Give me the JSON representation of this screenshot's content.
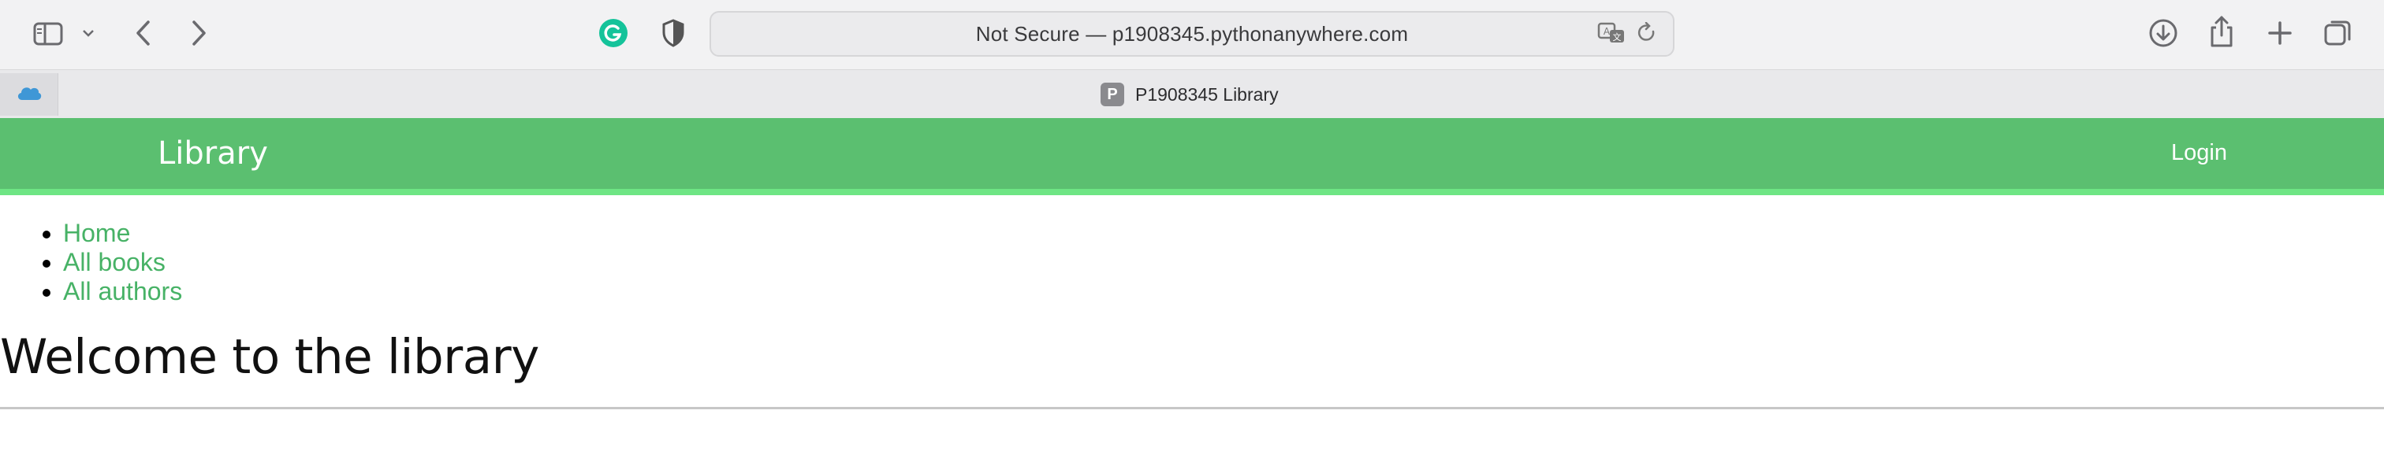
{
  "browser": {
    "address": "Not Secure — p1908345.pythonanywhere.com",
    "tab_title": "P1908345 Library",
    "tab_favicon_letter": "P",
    "icons": {
      "sidebar": "sidebar-icon",
      "sidebar_menu": "chevron-down-icon",
      "back": "back-arrow-icon",
      "forward": "forward-arrow-icon",
      "grammarly": "grammarly-icon",
      "privacy": "shield-icon",
      "translate": "translate-icon",
      "reload": "reload-icon",
      "downloads": "download-icon",
      "share": "share-icon",
      "new_tab": "plus-icon",
      "tab_overview": "tab-overview-icon",
      "pinned": "cloud-icon"
    }
  },
  "navbar": {
    "brand": "Library",
    "login": "Login",
    "color": "#5bbf70",
    "stripe_color": "#6ee584"
  },
  "nav_links": {
    "home": "Home",
    "books": "All books",
    "authors": "All authors"
  },
  "main": {
    "heading": "Welcome to the library"
  }
}
